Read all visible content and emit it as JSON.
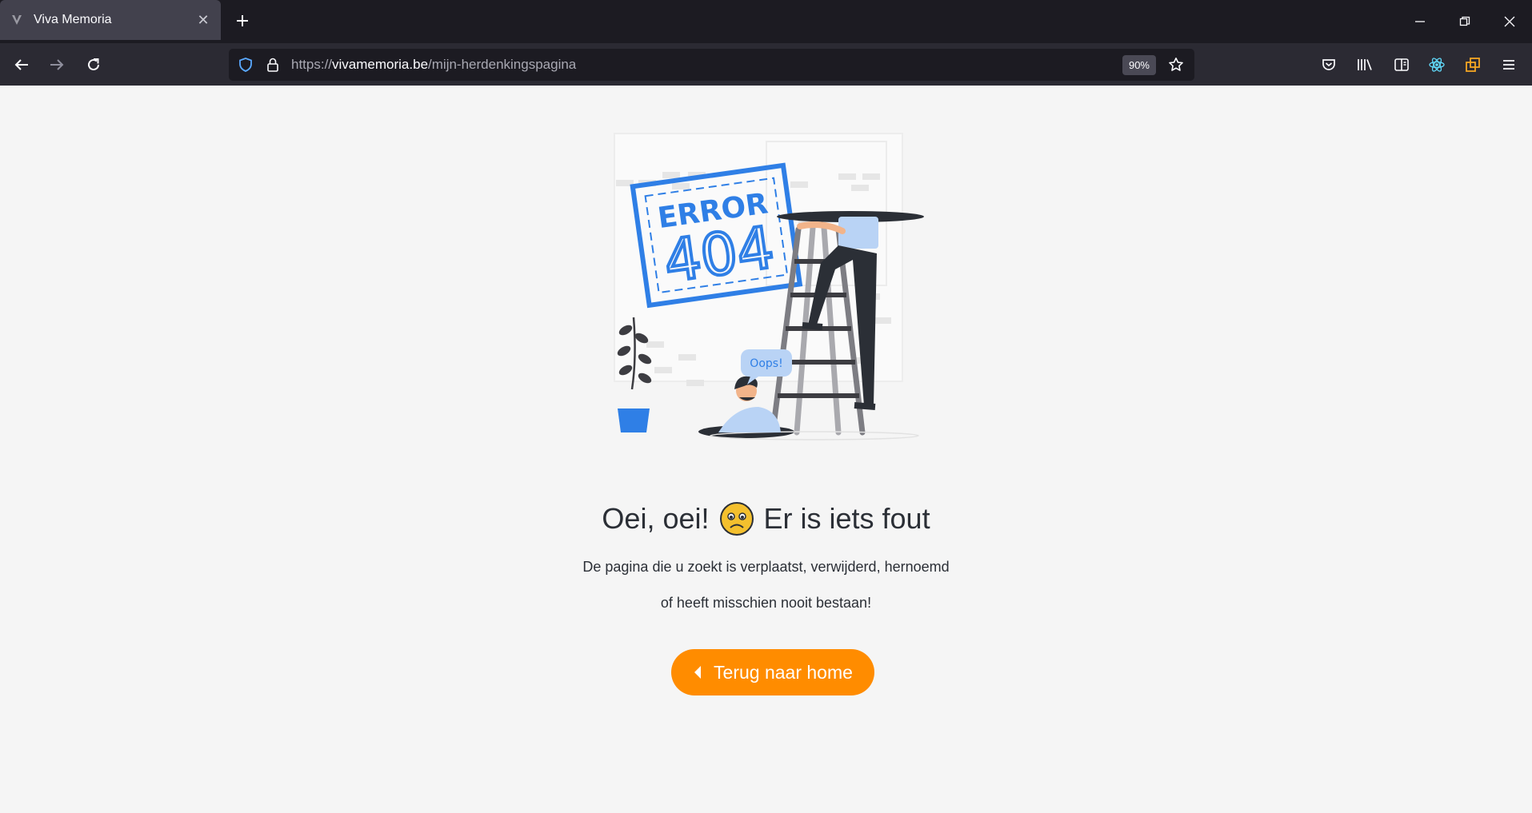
{
  "browser": {
    "tab": {
      "title": "Viva Memoria",
      "favicon": "viva-memoria-logo-icon",
      "close_icon": "close-icon"
    },
    "new_tab_icon": "plus-icon",
    "window_controls": [
      "minimize-icon",
      "restore-icon",
      "close-icon"
    ],
    "nav": {
      "back_icon": "arrow-left-icon",
      "forward_icon": "arrow-right-icon",
      "reload_icon": "reload-icon"
    },
    "url": {
      "scheme": "https://",
      "host": "vivamemoria.be",
      "path": "/mijn-herdenkingspagina",
      "zoom": "90%"
    },
    "toolbar_icons": [
      "pocket-icon",
      "library-icon",
      "sidebar-icon",
      "react-devtools-icon",
      "extension-icon",
      "menu-icon"
    ]
  },
  "page": {
    "illustration": {
      "sign_line1": "ERROR",
      "sign_line2": "404",
      "speech_bubble": "Oops!"
    },
    "heading_before": "Oei, oei!",
    "heading_after": "Er is iets fout",
    "paragraph_line1": "De pagina die u zoekt is verplaatst, verwijderd, hernoemd",
    "paragraph_line2": "of heeft misschien nooit bestaan!",
    "home_button": "Terug naar home",
    "accent_color": "#ff8c00"
  }
}
